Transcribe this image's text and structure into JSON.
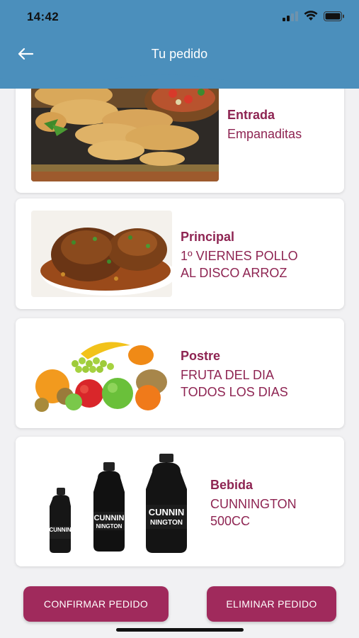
{
  "status_bar": {
    "time": "14:42"
  },
  "header": {
    "title": "Tu pedido",
    "back_icon": "arrow-left-icon"
  },
  "colors": {
    "header": "#4b8fbc",
    "accent": "#a02a5c",
    "text_accent": "#8e2452"
  },
  "items": [
    {
      "course": "Entrada",
      "dish_lines": [
        "Empanaditas"
      ],
      "image": "empanadas-photo"
    },
    {
      "course": "Principal",
      "dish_lines": [
        "1º VIERNES POLLO",
        "AL DISCO ARROZ"
      ],
      "image": "chicken-stew-photo"
    },
    {
      "course": "Postre",
      "dish_lines": [
        "FRUTA DEL DIA",
        "TODOS LOS DIAS"
      ],
      "image": "fruit-photo"
    },
    {
      "course": "Bebida",
      "dish_lines": [
        "CUNNINGTON",
        "500CC"
      ],
      "image": "cola-bottles-photo",
      "bottle_label_top": "CUNNIN",
      "bottle_label_bottom": "NINGTON"
    }
  ],
  "actions": {
    "confirm": "CONFIRMAR PEDIDO",
    "delete": "ELIMINAR PEDIDO"
  }
}
